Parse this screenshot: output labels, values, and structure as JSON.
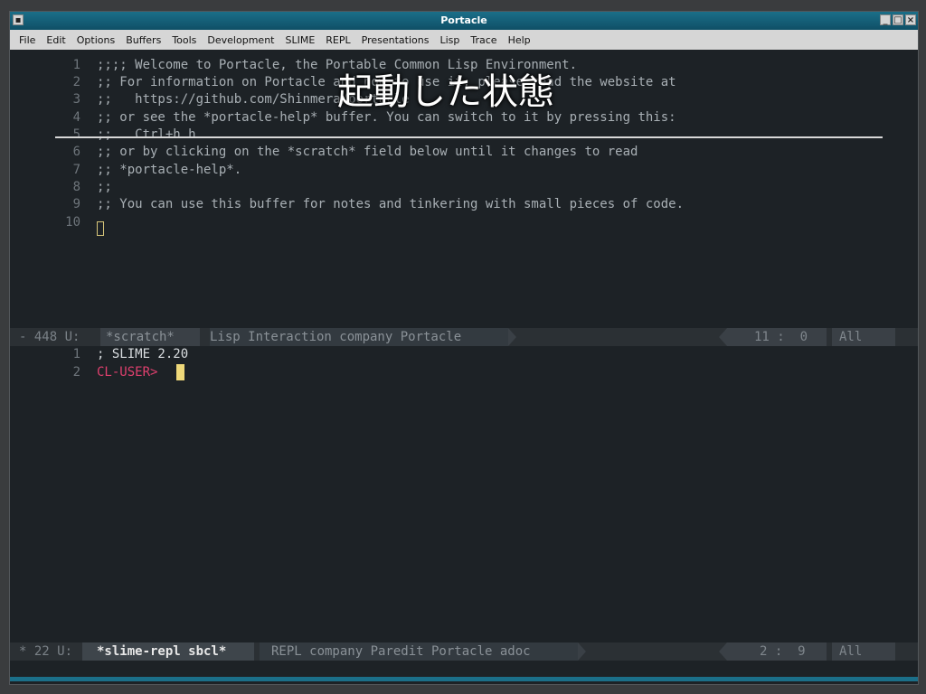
{
  "window": {
    "title": "Portacle",
    "menu_glyph": "▪",
    "buttons": [
      "_",
      "□",
      "×"
    ]
  },
  "menubar": [
    "File",
    "Edit",
    "Options",
    "Buffers",
    "Tools",
    "Development",
    "SLIME",
    "REPL",
    "Presentations",
    "Lisp",
    "Trace",
    "Help"
  ],
  "scratch": {
    "lines": [
      {
        "n": "1",
        "t": ";;;; Welcome to Portacle, the Portable Common Lisp Environment."
      },
      {
        "n": "2",
        "t": ";; For information on Portacle and how to use it, please read the website at"
      },
      {
        "n": "3",
        "t": ";;   https://github.com/Shinmera/portacle"
      },
      {
        "n": "4",
        "t": ";; or see the *portacle-help* buffer. You can switch to it by pressing this:"
      },
      {
        "n": "5",
        "t": ";;   Ctrl+h h"
      },
      {
        "n": "6",
        "t": ";; or by clicking on the *scratch* field below until it changes to read"
      },
      {
        "n": "7",
        "t": ";; *portacle-help*."
      },
      {
        "n": "8",
        "t": ";;"
      },
      {
        "n": "9",
        "t": ";; You can use this buffer for notes and tinkering with small pieces of code."
      },
      {
        "n": "10",
        "t": ""
      }
    ],
    "modeline": {
      "prefix": "- 448 U:",
      "buffer": "*scratch*",
      "modes": "Lisp Interaction company Portacle",
      "pos": "11 :  0",
      "scope": "All"
    }
  },
  "repl": {
    "lines": [
      {
        "n": "1",
        "t": "; SLIME 2.20"
      },
      {
        "n": "2",
        "t": "CL-USER> "
      }
    ],
    "prompt_color": "#e0406e",
    "modeline": {
      "prefix": "* 22 U:",
      "buffer": "*slime-repl sbcl*",
      "modes": "REPL company Paredit Portacle adoc",
      "pos": "2 :  9",
      "scope": "All"
    }
  },
  "overlay": {
    "caption": "起動した状態"
  },
  "colors": {
    "accent": "#1b6f89",
    "background": "#1d2226",
    "text": "#a9b0b5",
    "cursor": "#efd97a"
  }
}
